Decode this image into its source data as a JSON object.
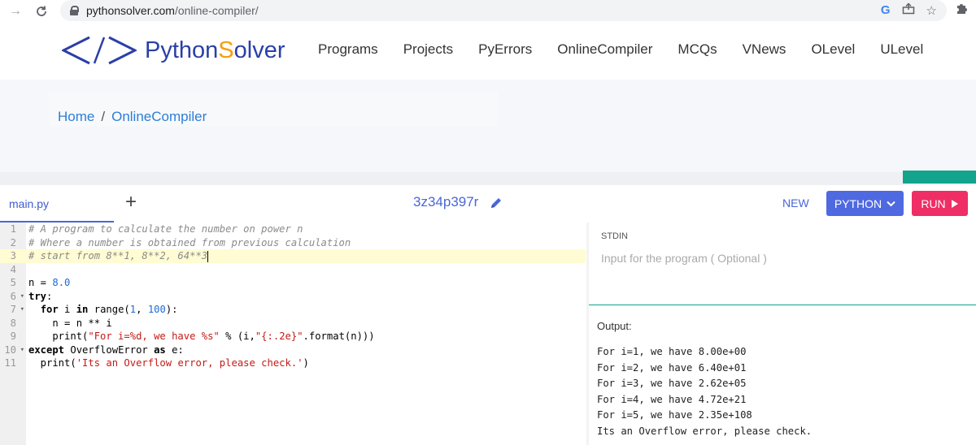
{
  "browser": {
    "url_domain": "pythonsolver.com",
    "url_path": "/online-compiler/"
  },
  "site": {
    "logo_main": "Python",
    "logo_accent": "S",
    "logo_rest": "olver",
    "nav": [
      "Programs",
      "Projects",
      "PyErrors",
      "OnlineCompiler",
      "MCQs",
      "VNews",
      "OLevel",
      "ULevel"
    ]
  },
  "breadcrumb": {
    "home": "Home",
    "sep": "/",
    "current": "OnlineCompiler"
  },
  "toolbar": {
    "file_tab": "main.py",
    "plus": "+",
    "project_id": "3z34p397r",
    "new_label": "NEW",
    "language": "PYTHON",
    "run_label": "RUN"
  },
  "editor": {
    "line_numbers": [
      "1",
      "2",
      "3",
      "4",
      "5",
      "6",
      "7",
      "8",
      "9",
      "10",
      "11"
    ]
  },
  "stdin": {
    "label": "STDIN",
    "placeholder": "Input for the program ( Optional )"
  },
  "output": {
    "label": "Output:",
    "lines": [
      "For i=1, we have 8.00e+00",
      "For i=2, we have 6.40e+01",
      "For i=3, we have 2.62e+05",
      "For i=4, we have 4.72e+21",
      "For i=5, we have 2.35e+108",
      "Its an Overflow error, please check."
    ]
  },
  "colors": {
    "brand_blue": "#2b3fa8",
    "accent_orange": "#f59e0b",
    "python_btn": "#4f6ae0",
    "run_btn": "#ef2e65",
    "teal": "#12a48c"
  }
}
